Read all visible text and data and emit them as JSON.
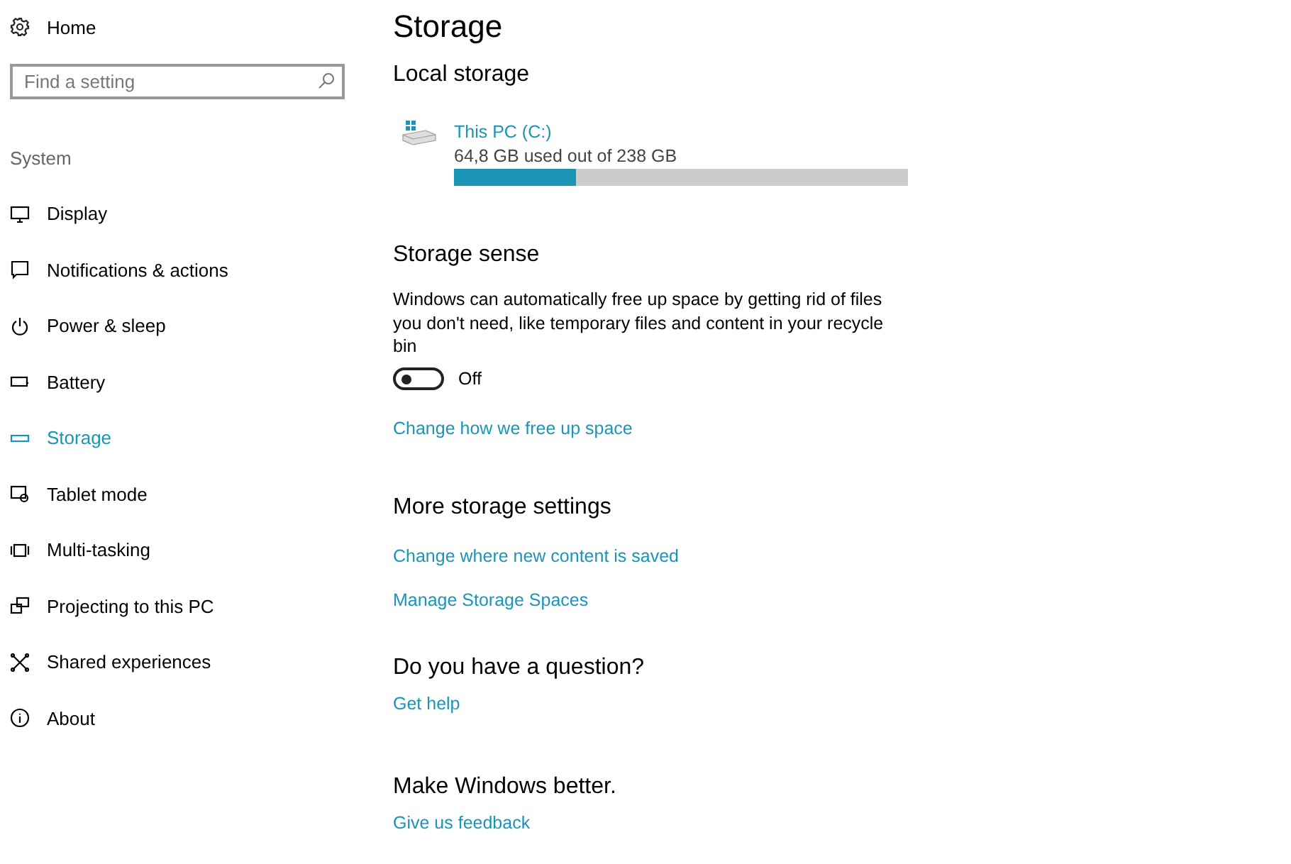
{
  "sidebar": {
    "home": "Home",
    "search": {
      "placeholder": "Find a setting"
    },
    "section": "System",
    "items": [
      {
        "label": "Display",
        "kind": "display",
        "selected": false
      },
      {
        "label": "Notifications & actions",
        "kind": "notifications",
        "selected": false
      },
      {
        "label": "Power & sleep",
        "kind": "power",
        "selected": false
      },
      {
        "label": "Battery",
        "kind": "battery",
        "selected": false
      },
      {
        "label": "Storage",
        "kind": "storage",
        "selected": true
      },
      {
        "label": "Tablet mode",
        "kind": "tablet",
        "selected": false
      },
      {
        "label": "Multi-tasking",
        "kind": "multitask",
        "selected": false
      },
      {
        "label": "Projecting to this PC",
        "kind": "project",
        "selected": false
      },
      {
        "label": "Shared experiences",
        "kind": "shared",
        "selected": false
      },
      {
        "label": "About",
        "kind": "about",
        "selected": false
      }
    ]
  },
  "page": {
    "title": "Storage",
    "local_storage": {
      "heading": "Local storage",
      "drive": {
        "name": "This PC (C:)",
        "usage": "64,8 GB used out of 238 GB",
        "level": 0.27
      }
    },
    "storage_sense": {
      "heading": "Storage sense",
      "description": "Windows can automatically free up space by getting rid of files you don't need, like temporary files and content in your recycle bin",
      "toggle": {
        "on": false,
        "label": "Off"
      },
      "link": "Change how we free up space"
    },
    "more_settings": {
      "heading": "More storage settings",
      "links": [
        "Change where new content is saved",
        "Manage Storage Spaces"
      ]
    },
    "question": {
      "heading": "Do you have a question?",
      "link": "Get help"
    },
    "feedback": {
      "heading": "Make Windows better.",
      "link": "Give us feedback"
    }
  }
}
